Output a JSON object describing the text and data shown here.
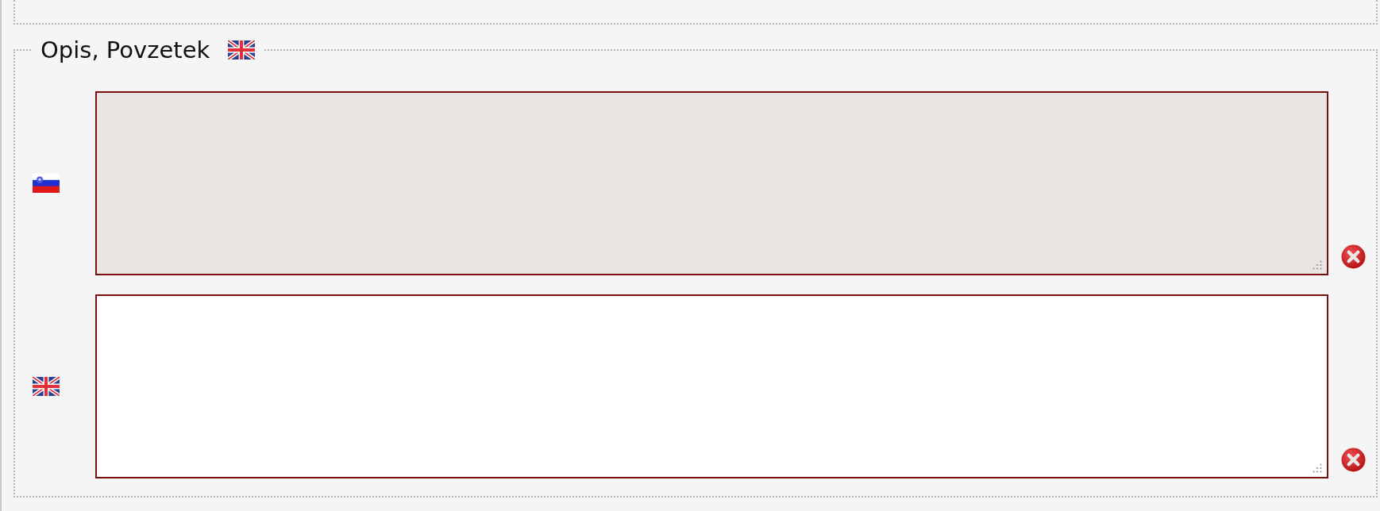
{
  "section": {
    "legend": "Opis, Povzetek"
  },
  "fields": [
    {
      "kind": "slovenian",
      "disabled": true
    },
    {
      "kind": "english",
      "disabled": false
    }
  ]
}
